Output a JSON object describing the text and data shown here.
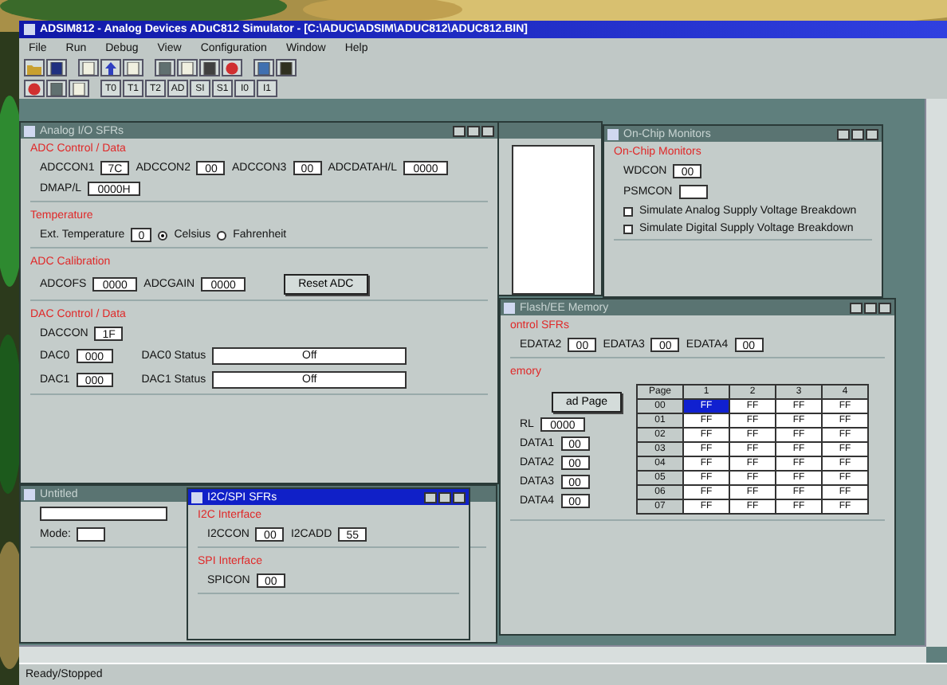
{
  "window": {
    "title": "ADSIM812 - Analog Devices ADuC812 Simulator - [C:\\ADUC\\ADSIM\\ADUC812\\ADUC812.BIN]"
  },
  "menu": [
    "File",
    "Run",
    "Debug",
    "View",
    "Configuration",
    "Window",
    "Help"
  ],
  "toolbar_labels": [
    "T0",
    "T1",
    "T2",
    "AD",
    "SI",
    "S1",
    "I0",
    "I1"
  ],
  "windows": [
    {
      "kind": "list"
    },
    {
      "kind": "monitors",
      "title": "On-Chip Monitors",
      "active": false,
      "sections": [
        {
          "heading": "On-Chip Monitors",
          "rows": [
            [
              {
                "kind": "field",
                "label": "WDCON",
                "value": "00"
              }
            ],
            [
              {
                "kind": "field",
                "label": "PSMCON"
              }
            ],
            [
              {
                "kind": "check",
                "label": "Simulate Analog Supply Voltage Breakdown",
                "checked": false
              }
            ],
            [
              {
                "kind": "check",
                "label": "Simulate Digital Supply Voltage Breakdown",
                "checked": false
              }
            ]
          ]
        }
      ]
    },
    {
      "kind": "log",
      "title": "Untitled",
      "active": false,
      "sections": [
        {
          "rows": [
            [
              {
                "kind": "field"
              }
            ],
            [
              {
                "kind": "field",
                "label": "Mode:"
              }
            ]
          ]
        }
      ]
    },
    {
      "kind": "flash",
      "title": "Flash/EE Memory",
      "active": false,
      "sections": [
        {
          "heading": "ontrol SFRs",
          "rows": [
            [
              {
                "kind": "field",
                "label": "EDATA2",
                "value": "00"
              },
              {
                "kind": "field",
                "label": "EDATA3",
                "value": "00"
              },
              {
                "kind": "field",
                "label": "EDATA4",
                "value": "00"
              }
            ]
          ]
        },
        {
          "heading": "emory",
          "rows": [
            [
              {
                "kind": "column",
                "items": [
                  {
                    "kind": "button",
                    "label": "ad Page"
                  },
                  {
                    "kind": "field",
                    "label": "RL",
                    "value": "0000"
                  },
                  {
                    "kind": "field",
                    "label": "DATA1",
                    "value": "00"
                  },
                  {
                    "kind": "field",
                    "label": "DATA2",
                    "value": "00"
                  },
                  {
                    "kind": "field",
                    "label": "DATA3",
                    "value": "00"
                  },
                  {
                    "kind": "field",
                    "label": "DATA4",
                    "value": "00"
                  }
                ]
              },
              {
                "kind": "grid",
                "columns": [
                  "Page",
                  "1",
                  "2",
                  "3",
                  "4"
                ],
                "rows": [
                  [
                    {
                      "text": "00",
                      "selected": false
                    },
                    {
                      "text": "FF",
                      "selected": true
                    },
                    {
                      "text": "FF",
                      "selected": false
                    },
                    {
                      "text": "FF",
                      "selected": false
                    },
                    {
                      "text": "FF",
                      "selected": false
                    }
                  ],
                  [
                    {
                      "text": "01",
                      "selected": false
                    },
                    {
                      "text": "FF",
                      "selected": false
                    },
                    {
                      "text": "FF",
                      "selected": false
                    },
                    {
                      "text": "FF",
                      "selected": false
                    },
                    {
                      "text": "FF",
                      "selected": false
                    }
                  ],
                  [
                    {
                      "text": "02",
                      "selected": false
                    },
                    {
                      "text": "FF",
                      "selected": false
                    },
                    {
                      "text": "FF",
                      "selected": false
                    },
                    {
                      "text": "FF",
                      "selected": false
                    },
                    {
                      "text": "FF",
                      "selected": false
                    }
                  ],
                  [
                    {
                      "text": "03",
                      "selected": false
                    },
                    {
                      "text": "FF",
                      "selected": false
                    },
                    {
                      "text": "FF",
                      "selected": false
                    },
                    {
                      "text": "FF",
                      "selected": false
                    },
                    {
                      "text": "FF",
                      "selected": false
                    }
                  ],
                  [
                    {
                      "text": "04",
                      "selected": false
                    },
                    {
                      "text": "FF",
                      "selected": false
                    },
                    {
                      "text": "FF",
                      "selected": false
                    },
                    {
                      "text": "FF",
                      "selected": false
                    },
                    {
                      "text": "FF",
                      "selected": false
                    }
                  ],
                  [
                    {
                      "text": "05",
                      "selected": false
                    },
                    {
                      "text": "FF",
                      "selected": false
                    },
                    {
                      "text": "FF",
                      "selected": false
                    },
                    {
                      "text": "FF",
                      "selected": false
                    },
                    {
                      "text": "FF",
                      "selected": false
                    }
                  ],
                  [
                    {
                      "text": "06",
                      "selected": false
                    },
                    {
                      "text": "FF",
                      "selected": false
                    },
                    {
                      "text": "FF",
                      "selected": false
                    },
                    {
                      "text": "FF",
                      "selected": false
                    },
                    {
                      "text": "FF",
                      "selected": false
                    }
                  ],
                  [
                    {
                      "text": "07",
                      "selected": false
                    },
                    {
                      "text": "FF",
                      "selected": false
                    },
                    {
                      "text": "FF",
                      "selected": false
                    },
                    {
                      "text": "FF",
                      "selected": false
                    },
                    {
                      "text": "FF",
                      "selected": false
                    }
                  ]
                ]
              }
            ]
          ]
        }
      ]
    },
    {
      "kind": "analog",
      "title": "Analog I/O SFRs",
      "active": false,
      "sections": [
        {
          "heading": "ADC Control / Data",
          "rows": [
            [
              {
                "kind": "field",
                "label": "ADCCON1",
                "value": "7C"
              },
              {
                "kind": "field",
                "label": "ADCCON2",
                "value": "00"
              },
              {
                "kind": "field",
                "label": "ADCCON3",
                "value": "00"
              },
              {
                "kind": "field",
                "label": "ADCDATAH/L",
                "value": "0000"
              }
            ],
            [
              {
                "kind": "field",
                "label": "DMAP/L",
                "value": "0000H"
              }
            ]
          ]
        },
        {
          "heading": "Temperature",
          "rows": [
            [
              {
                "kind": "field",
                "label": "Ext. Temperature",
                "value": "0"
              },
              {
                "kind": "radio",
                "label": "Celsius",
                "selected": true
              },
              {
                "kind": "radio",
                "label": "Fahrenheit",
                "selected": false
              }
            ]
          ]
        },
        {
          "heading": "ADC Calibration",
          "rows": [
            [
              {
                "kind": "field",
                "label": "ADCOFS",
                "value": "0000"
              },
              {
                "kind": "field",
                "label": "ADCGAIN",
                "value": "0000"
              },
              {
                "kind": "button",
                "label": "Reset ADC"
              }
            ]
          ]
        },
        {
          "heading": "DAC Control / Data",
          "rows": [
            [
              {
                "kind": "field",
                "label": "DACCON",
                "value": "1F"
              }
            ],
            [
              {
                "kind": "field",
                "label": "DAC0",
                "value": "000"
              },
              {
                "kind": "status",
                "label": "DAC0 Status",
                "value": "Off"
              }
            ],
            [
              {
                "kind": "field",
                "label": "DAC1",
                "value": "000"
              },
              {
                "kind": "status",
                "label": "DAC1 Status",
                "value": "Off"
              }
            ]
          ]
        }
      ]
    },
    {
      "kind": "serial",
      "title": "I2C/SPI SFRs",
      "active": true,
      "sections": [
        {
          "heading": "I2C Interface",
          "rows": [
            [
              {
                "kind": "field",
                "label": "I2CCON",
                "value": "00"
              },
              {
                "kind": "field",
                "label": "I2CADD",
                "value": "55"
              }
            ]
          ]
        },
        {
          "heading": "SPI Interface",
          "rows": [
            [
              {
                "kind": "field",
                "label": "SPICON",
                "value": "00"
              }
            ]
          ]
        }
      ]
    }
  ],
  "status_bar": "Ready/Stopped"
}
